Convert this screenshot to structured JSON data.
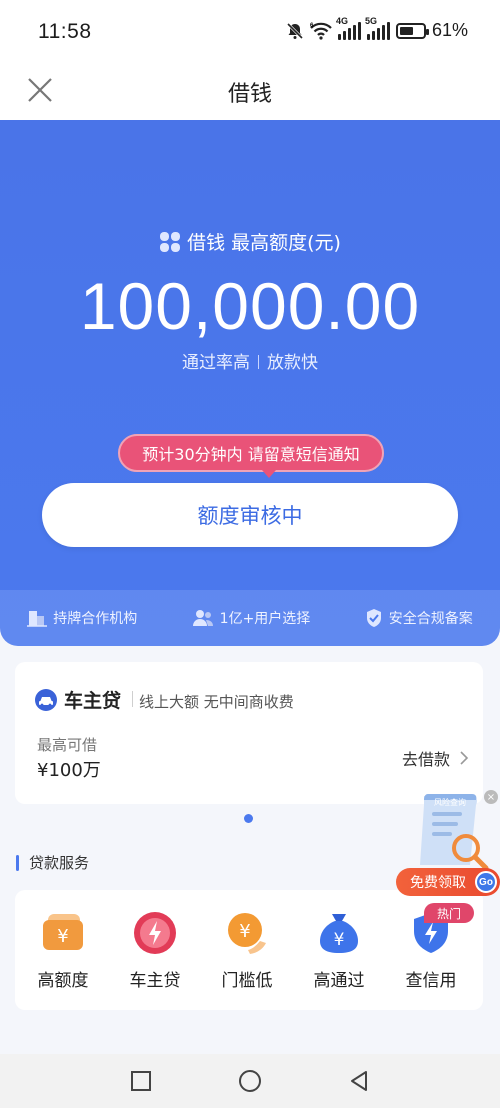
{
  "status_bar": {
    "time": "11:58",
    "battery": "61%",
    "battery_level": 0.61,
    "net1": "4G",
    "net2": "5G",
    "wifi_tag": "6"
  },
  "title_bar": {
    "title": "借钱"
  },
  "hero": {
    "label": "借钱 最高额度(元)",
    "amount": "100,000.00",
    "sub_left": "通过率高",
    "sub_right": "放款快",
    "tip": "预计30分钟内 请留意短信通知",
    "button": "额度审核中"
  },
  "features": [
    {
      "label": "持牌合作机构",
      "icon": "building-icon"
    },
    {
      "label": "1亿+用户选择",
      "icon": "users-icon"
    },
    {
      "label": "安全合规备案",
      "icon": "shield-check-icon"
    }
  ],
  "loan_card": {
    "title": "车主贷",
    "desc": "线上大额 无中间商收费",
    "limit_label": "最高可借",
    "limit_value": "¥100万",
    "action": "去借款"
  },
  "section": {
    "title": "贷款服务"
  },
  "services": [
    {
      "label": "高额度",
      "icon": "yuan-card-icon"
    },
    {
      "label": "车主贷",
      "icon": "lightning-icon"
    },
    {
      "label": "门槛低",
      "icon": "yuan-hand-icon"
    },
    {
      "label": "高通过",
      "icon": "money-bag-icon"
    },
    {
      "label": "查信用",
      "icon": "shield-lightning-icon"
    }
  ],
  "float_ad": {
    "label": "免费领取",
    "go": "Go",
    "badge": "热门",
    "paper_text": "风险查询"
  },
  "colors": {
    "primary": "#4b79ee",
    "tip": "#e95378",
    "ad": "#f2623b"
  }
}
